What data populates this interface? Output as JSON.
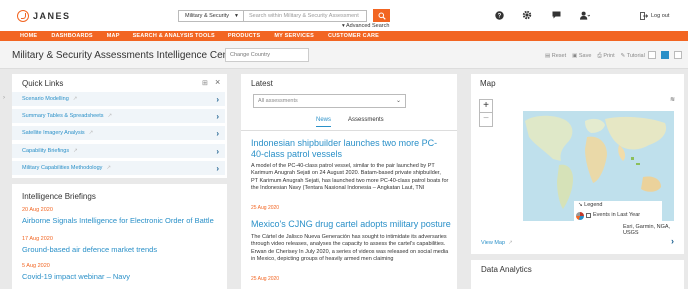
{
  "header": {
    "logo_text": "JANES",
    "search_scope": "Military & Security",
    "search_placeholder": "Search within Military & Security Assessment",
    "advanced_search": "Advanced Search",
    "logout": "Log out"
  },
  "nav": [
    "HOME",
    "DASHBOARDS",
    "MAP",
    "SEARCH & ANALYSIS TOOLS",
    "PRODUCTS",
    "MY SERVICES",
    "CUSTOMER CARE"
  ],
  "page": {
    "title": "Military & Security Assessments Intelligence Centre",
    "country_placeholder": "Change Country",
    "tools": [
      "Reset",
      "Save",
      "Print",
      "Tutorial"
    ]
  },
  "quick_links": {
    "title": "Quick Links",
    "items": [
      "Scenario Modelling",
      "Summary Tables & Spreadsheets",
      "Satellite Imagery Analysis",
      "Capability Briefings",
      "Military Capabilities Methodology"
    ]
  },
  "briefings": {
    "title": "Intelligence Briefings",
    "items": [
      {
        "date": "20 Aug 2020",
        "title": "Airborne Signals Intelligence for Electronic Order of Battle"
      },
      {
        "date": "17 Aug 2020",
        "title": "Ground-based air defence market trends"
      },
      {
        "date": "5 Aug 2020",
        "title": "Covid-19 impact webinar – Navy"
      }
    ]
  },
  "latest": {
    "title": "Latest",
    "filter": "All assessments",
    "tabs": [
      "News",
      "Assessments"
    ],
    "news": [
      {
        "title": "Indonesian shipbuilder launches two more PC-40-class patrol vessels",
        "body": "A model of the PC-40-class patrol vessel, similar to the pair launched by PT Karimum Anugrah Sejati on 24 August 2020. Batam-based private shipbuilder, PT Karimum Anugrah Sejati, has launched two more PC-40-class patrol boats for the Indonesian Navy (Tentara Nasional Indonesia – Angkatan Laut, TNI",
        "date": "25 Aug 2020"
      },
      {
        "title": "Mexico's CJNG drug cartel adopts military posture",
        "body": "The Cártel de Jalisco Nueva Generación has sought to intimidate its adversaries through video releases, analyses the capacity to assess the cartel's capabilities. Erwan de Cherisey In July 2020, a series of videos was released on social media in Mexico, depicting groups of heavily armed men claiming",
        "date": "25 Aug 2020"
      }
    ]
  },
  "map": {
    "title": "Map",
    "legend": "Legend",
    "layer": "Events in Last Year",
    "attribution": "Esri, Garmin, NGA, USGS",
    "view_map": "View Map"
  },
  "analytics": {
    "title": "Data Analytics"
  },
  "colors": {
    "accent": "#f26522",
    "link": "#2a90c8"
  }
}
